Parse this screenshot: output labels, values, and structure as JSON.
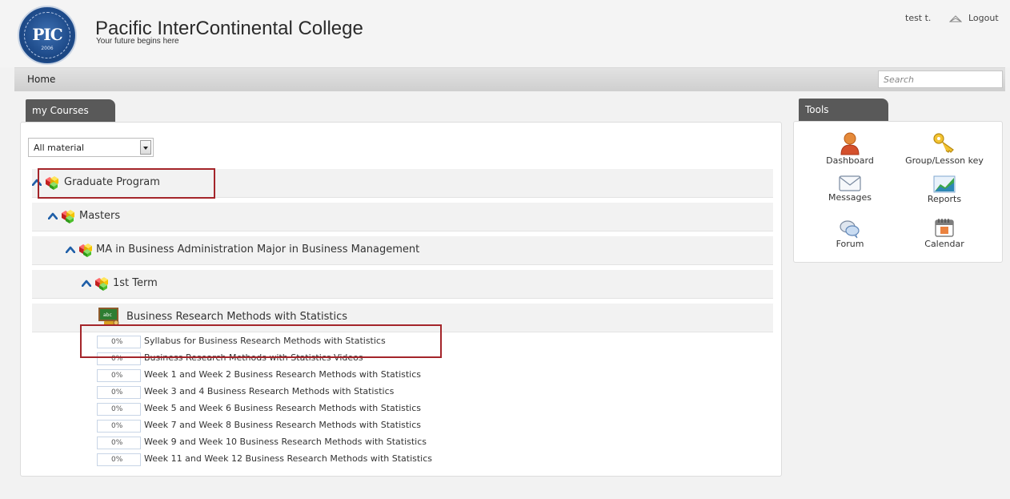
{
  "header": {
    "logo_text": "PIC",
    "logo_year": "2006",
    "site_title": "Pacific InterContinental College",
    "tagline": "Your future begins here",
    "user_name": "test t.",
    "logout_label": "Logout"
  },
  "nav": {
    "home_label": "Home",
    "search_placeholder": "Search"
  },
  "courses_panel": {
    "tab_label": "my Courses",
    "filter_selected": "All material",
    "tree": {
      "program": "Graduate Program",
      "level": "Masters",
      "degree": "MA in Business Administration Major in Business Management",
      "term": "1st Term",
      "course": "Business Research Methods with Statistics"
    },
    "lessons": [
      {
        "progress": "0%",
        "title": "Syllabus for Business Research Methods with Statistics"
      },
      {
        "progress": "0%",
        "title": "Business Research Methods with Statistics Videos"
      },
      {
        "progress": "0%",
        "title": "Week 1 and Week 2 Business Research Methods with Statistics"
      },
      {
        "progress": "0%",
        "title": "Week 3 and 4 Business Research Methods with Statistics"
      },
      {
        "progress": "0%",
        "title": "Week 5 and Week 6 Business Research Methods with Statistics"
      },
      {
        "progress": "0%",
        "title": "Week 7 and Week 8 Business Research Methods with Statistics"
      },
      {
        "progress": "0%",
        "title": "Week 9 and Week 10 Business Research Methods with Statistics"
      },
      {
        "progress": "0%",
        "title": "Week 11 and Week 12 Business Research Methods with Statistics"
      }
    ]
  },
  "tools_panel": {
    "tab_label": "Tools",
    "items": [
      {
        "label": "Dashboard",
        "icon": "user-icon"
      },
      {
        "label": "Group/Lesson key",
        "icon": "key-icon"
      },
      {
        "label": "Messages",
        "icon": "envelope-icon"
      },
      {
        "label": "Reports",
        "icon": "chart-icon"
      },
      {
        "label": "Forum",
        "icon": "speech-bubbles-icon"
      },
      {
        "label": "Calendar",
        "icon": "calendar-icon"
      }
    ]
  },
  "colors": {
    "highlight_box": "#a4252a",
    "tab_background": "#595959",
    "chevron": "#1f5fa8"
  }
}
